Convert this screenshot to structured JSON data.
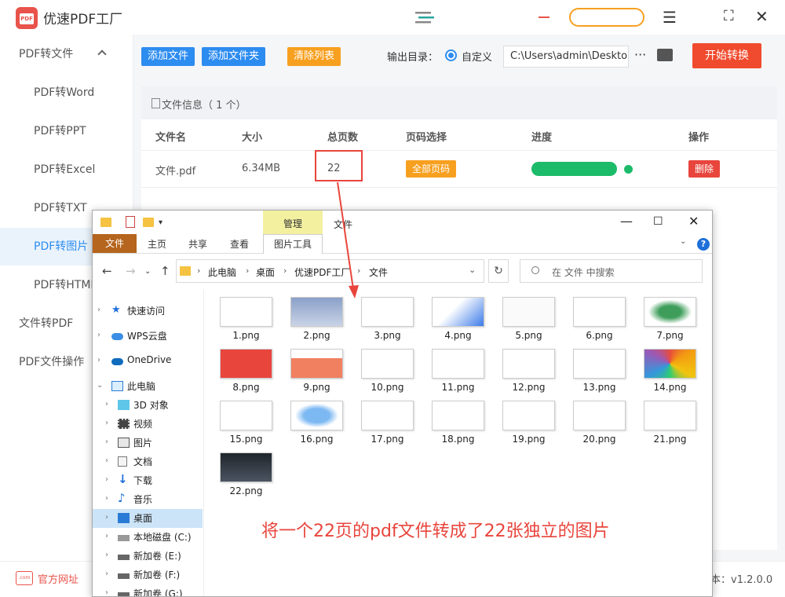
{
  "app": {
    "title": "优速PDF工厂",
    "logo_text": "PDF"
  },
  "sidebar": {
    "items": [
      {
        "label": "PDF转文件"
      },
      {
        "label": "PDF转Word"
      },
      {
        "label": "PDF转PPT"
      },
      {
        "label": "PDF转Excel"
      },
      {
        "label": "PDF转TXT"
      },
      {
        "label": "PDF转图片"
      },
      {
        "label": "PDF转HTML"
      },
      {
        "label": "文件转PDF"
      },
      {
        "label": "PDF文件操作"
      }
    ]
  },
  "toolbar": {
    "add_file": "添加文件",
    "add_folder": "添加文件夹",
    "clear_list": "清除列表",
    "output_label": "输出目录：",
    "radio_label": "自定义",
    "path_value": "C:\\Users\\admin\\Deskto",
    "more": "···",
    "start": "开始转换"
  },
  "panel": {
    "title": "文件信息（ 1 个）",
    "headers": [
      "文件名",
      "大小",
      "总页数",
      "页码选择",
      "进度",
      "操作"
    ],
    "row": {
      "name": "文件.pdf",
      "size": "6.34MB",
      "pages": "22",
      "page_select": "全部页码",
      "progress": 1.0,
      "action": "删除"
    }
  },
  "footer": {
    "icon_text": ".com",
    "link": "官方网址",
    "version": "本：v1.2.0.0"
  },
  "explorer": {
    "manage_tab": "管理",
    "window_title": "文件",
    "ribbon": {
      "file": "文件",
      "tabs": [
        "主页",
        "共享",
        "查看"
      ],
      "picture_tools": "图片工具"
    },
    "breadcrumb": [
      "此电脑",
      "桌面",
      "优速PDF工厂",
      "文件"
    ],
    "search_placeholder": "在 文件 中搜索",
    "tree": [
      {
        "label": "快速访问"
      },
      {
        "label": "WPS云盘"
      },
      {
        "label": "OneDrive"
      },
      {
        "label": "此电脑"
      },
      {
        "label": "3D 对象"
      },
      {
        "label": "视频"
      },
      {
        "label": "图片"
      },
      {
        "label": "文档"
      },
      {
        "label": "下载"
      },
      {
        "label": "音乐"
      },
      {
        "label": "桌面"
      },
      {
        "label": "本地磁盘 (C:)"
      },
      {
        "label": "新加卷 (E:)"
      },
      {
        "label": "新加卷 (F:)"
      },
      {
        "label": "新加卷 (G:)"
      }
    ],
    "files": [
      "1.png",
      "2.png",
      "3.png",
      "4.png",
      "5.png",
      "6.png",
      "7.png",
      "8.png",
      "9.png",
      "10.png",
      "11.png",
      "12.png",
      "13.png",
      "14.png",
      "15.png",
      "16.png",
      "17.png",
      "18.png",
      "19.png",
      "20.png",
      "21.png",
      "22.png"
    ]
  },
  "note": "将一个22页的pdf文件转成了22张独立的图片",
  "colors": {
    "accent_blue": "#2d8cf0",
    "accent_orange": "#f7a020",
    "accent_red": "#f04b2e",
    "progress_green": "#1cbb6a"
  }
}
